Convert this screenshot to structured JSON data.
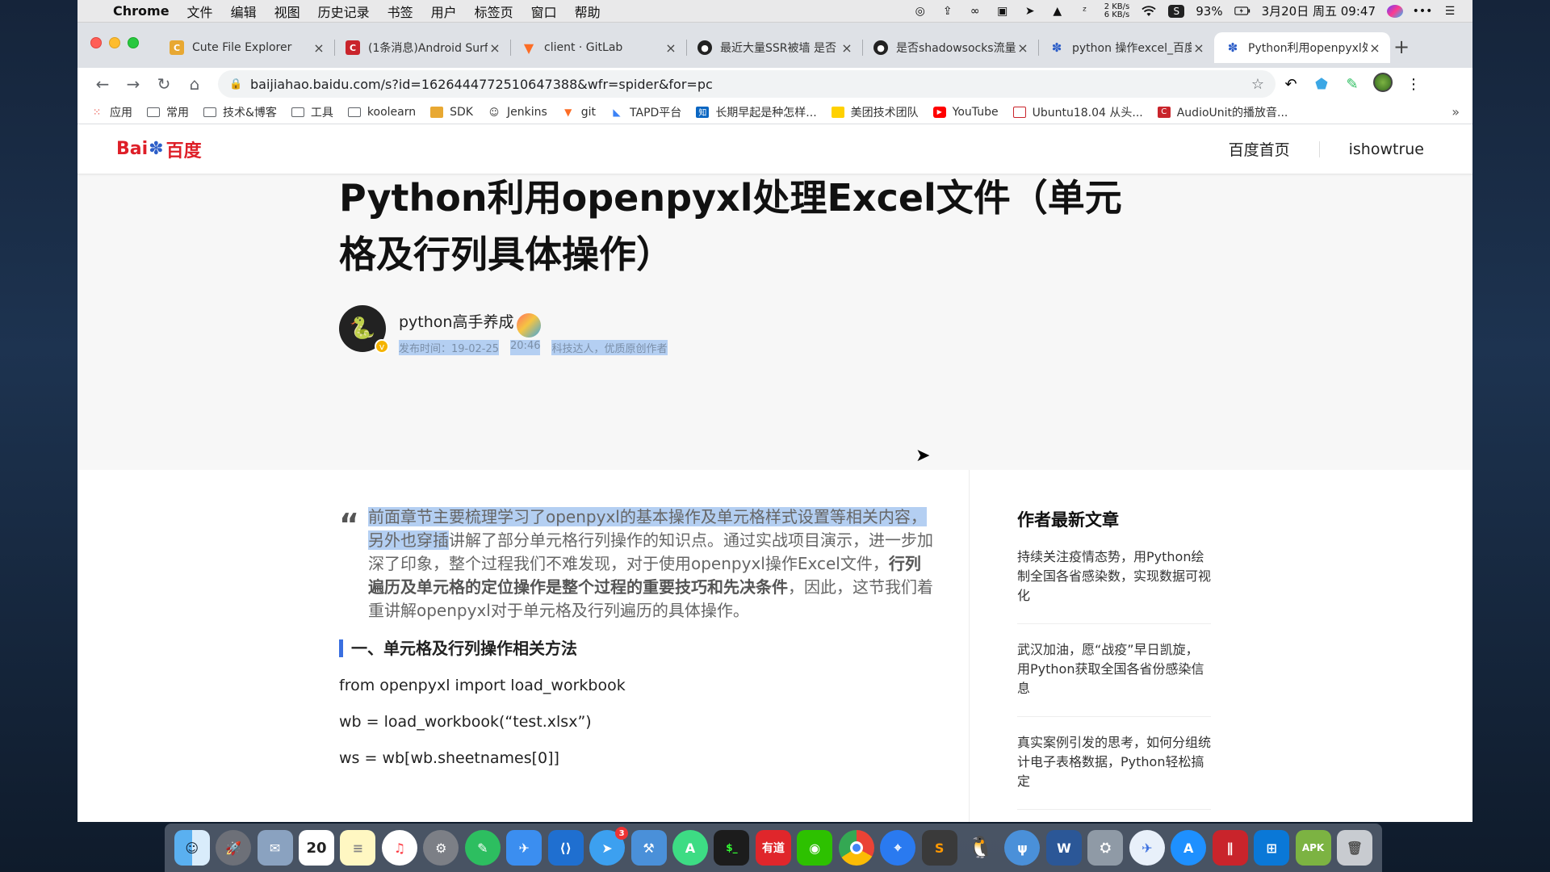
{
  "menubar": {
    "app_name": "Chrome",
    "items": [
      "文件",
      "编辑",
      "视图",
      "历史记录",
      "书签",
      "用户",
      "标签页",
      "窗口",
      "帮助"
    ],
    "net_up": "2 KB/s",
    "net_down": "6 KB/s",
    "battery": "93%",
    "datetime": "3月20日 周五  09:47"
  },
  "tabs": [
    {
      "title": "Cute File Explorer",
      "color": "#e8a832"
    },
    {
      "title": "(1条消息)Android Surf",
      "color": "#c9242b"
    },
    {
      "title": "client · GitLab",
      "color": "#fc6d26"
    },
    {
      "title": "最近大量SSR被墙 是否",
      "color": "#222222"
    },
    {
      "title": "是否shadowsocks流量",
      "color": "#222222"
    },
    {
      "title": "python 操作excel_百度",
      "color": "#2d5ec8"
    },
    {
      "title": "Python利用openpyxl处",
      "color": "#2d5ec8"
    }
  ],
  "address": {
    "url": "baijiahao.baidu.com/s?id=1626444772510647388&wfr=spider&for=pc"
  },
  "bookmarks": [
    {
      "label": "应用",
      "icon": "apps-grid-icon"
    },
    {
      "label": "常用",
      "icon": "folder-icon"
    },
    {
      "label": "技术&博客",
      "icon": "folder-icon"
    },
    {
      "label": "工具",
      "icon": "folder-icon"
    },
    {
      "label": "koolearn",
      "icon": "folder-icon"
    },
    {
      "label": "SDK",
      "icon": "cute-icon"
    },
    {
      "label": "Jenkins",
      "icon": "jenkins-icon"
    },
    {
      "label": "git",
      "icon": "gitlab-icon"
    },
    {
      "label": "TAPD平台",
      "icon": "tapd-icon"
    },
    {
      "label": "长期早起是种怎样...",
      "icon": "zhihu-icon"
    },
    {
      "label": "美团技术团队",
      "icon": "meituan-icon"
    },
    {
      "label": "YouTube",
      "icon": "youtube-icon"
    },
    {
      "label": "Ubuntu18.04 从头...",
      "icon": "bookmark-icon"
    },
    {
      "label": "AudioUnit的播放音...",
      "icon": "csdn-icon"
    }
  ],
  "site": {
    "logo_bai": "Bai",
    "logo_cn": "百度",
    "nav_home": "百度首页",
    "user": "ishowtrue"
  },
  "article": {
    "title": "Python利用openpyxl处理Excel文件（单元格及行列具体操作）",
    "author": "python高手养成",
    "publish_label": "发布时间：19-02-25",
    "publish_time": "20:46",
    "author_tag": "科技达人，优质原创作者",
    "summary_highlight": "前面章节主要梳理学习了openpyxl的基本操作及单元格样式设置等相关内容，另外也穿插",
    "summary_rest": "讲解了部分单元格行列操作的知识点。通过实战项目演示，进一步加深了印象，整个过程我们不难发现，对于使用openpyxl操作Excel文件，",
    "summary_bold": "行列遍历及单元格的定位操作是整个过程的重要技巧和先决条件",
    "summary_tail": "，因此，这节我们着重讲解openpyxl对于单元格及行列遍历的具体操作。",
    "section_title": "一、单元格及行列操作相关方法",
    "code": [
      "from openpyxl import load_workbook",
      "wb = load_workbook(“test.xlsx”)",
      "ws = wb[wb.sheetnames[0]]"
    ]
  },
  "sidebar": {
    "heading": "作者最新文章",
    "items": [
      "持续关注疫情态势，用Python绘制全国各省感染数，实现数据可视化",
      "武汉加油，愿“战疫”早日凯旋，用Python获取全国各省份感染信息",
      "真实案例引发的思考，如何分组统计电子表格数据，Python轻松搞定"
    ]
  },
  "dock": {
    "calendar_day": "20",
    "youdao": "有道",
    "apk": "APK",
    "apps": [
      "finder-icon",
      "launchpad-icon",
      "preview-icon",
      "calendar-icon",
      "notes-icon",
      "music-icon",
      "system-preferences-icon",
      "evernote-icon",
      "xcode-icon",
      "vscode-icon",
      "feishu-icon",
      "instruments-icon",
      "android-studio-icon",
      "terminal-icon",
      "youdao-icon",
      "wechat-icon",
      "chrome-icon",
      "maps-icon",
      "sublime-icon",
      "qq-icon",
      "fork-icon",
      "word-icon",
      "disk-utility-icon",
      "mail-icon",
      "app-store-icon",
      "parallels-icon",
      "windows-icon",
      "apk-icon",
      "trash-icon"
    ],
    "notification_badge": "3"
  },
  "colors": {
    "accent_blue": "#3a6fe0",
    "selection": "#b4cff2",
    "baidu_red": "#de1f28",
    "baidu_blue": "#2d5ec8"
  }
}
